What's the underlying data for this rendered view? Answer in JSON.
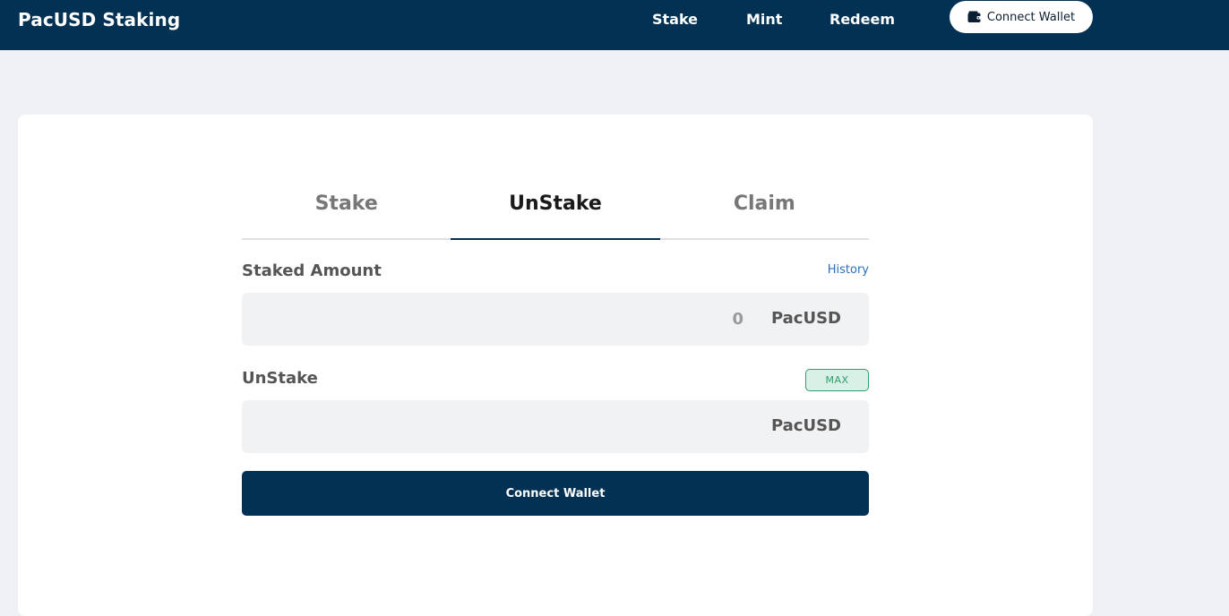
{
  "header": {
    "brand": "PacUSD Staking",
    "nav": [
      "Stake",
      "Mint",
      "Redeem"
    ],
    "wallet_button": "Connect Wallet",
    "wallet_icon": "wallet-icon"
  },
  "tabs": {
    "items": [
      "Stake",
      "UnStake",
      "Claim"
    ],
    "active": "UnStake"
  },
  "staked": {
    "label": "Staked Amount",
    "history": "History",
    "value": "0",
    "unit": "PacUSD"
  },
  "unstake": {
    "label": "UnStake",
    "max": "MAX",
    "value": "",
    "unit": "PacUSD"
  },
  "action": {
    "button": "Connect Wallet"
  },
  "colors": {
    "header_bg": "#023154",
    "page_bg": "#eef0f4",
    "accent_green": "#2f9e6e",
    "link_blue": "#2a6fc0"
  }
}
